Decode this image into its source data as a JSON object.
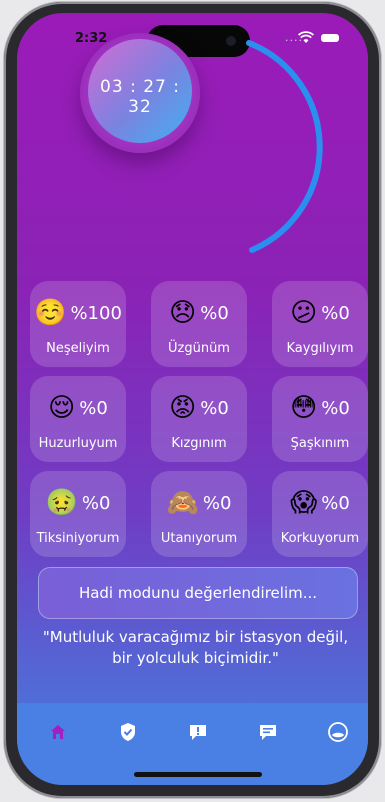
{
  "status_bar": {
    "time": "2:32",
    "signal_dots": "...."
  },
  "timer": {
    "display": "03 : 27 : 32"
  },
  "moods": [
    {
      "emoji": "☺️",
      "percent": "%100",
      "label": "Neşeliyim"
    },
    {
      "emoji": "😞",
      "percent": "%0",
      "label": "Üzgünüm"
    },
    {
      "emoji": "😕",
      "percent": "%0",
      "label": "Kaygılıyım"
    },
    {
      "emoji": "😌",
      "percent": "%0",
      "label": "Huzurluyum"
    },
    {
      "emoji": "😡",
      "percent": "%0",
      "label": "Kızgınım"
    },
    {
      "emoji": "😳",
      "percent": "%0",
      "label": "Şaşkınım"
    },
    {
      "emoji": "🤢",
      "percent": "%0",
      "label": "Tiksiniyorum"
    },
    {
      "emoji": "🙈",
      "percent": "%0",
      "label": "Utanıyorum"
    },
    {
      "emoji": "😱",
      "percent": "%0",
      "label": "Korkuyorum"
    }
  ],
  "cta": {
    "label": "Hadi modunu değerlendirelim..."
  },
  "quote": {
    "line1": "\"Mutluluk varacağımız bir istasyon değil,",
    "line2": "bir yolculuk biçimidir.\""
  },
  "tabbar": {
    "items": [
      {
        "icon": "home-icon",
        "active": true
      },
      {
        "icon": "shield-check-icon",
        "active": false
      },
      {
        "icon": "alert-message-icon",
        "active": false
      },
      {
        "icon": "chat-icon",
        "active": false
      },
      {
        "icon": "profile-icon",
        "active": false
      }
    ]
  },
  "colors": {
    "accent_active": "#a020c0",
    "arc": "#2b8ff0"
  }
}
